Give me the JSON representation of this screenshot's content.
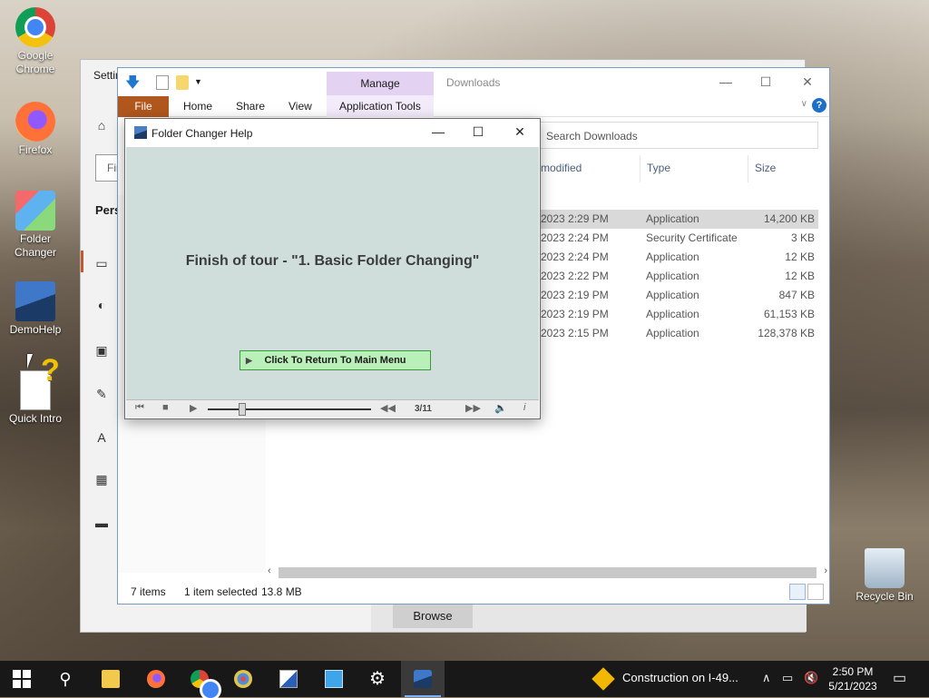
{
  "desktop": {
    "icons": [
      {
        "label": "Google\nChrome",
        "icon": "chrome-icon"
      },
      {
        "label": "Firefox",
        "icon": "firefox-icon"
      },
      {
        "label": "Folder\nChanger",
        "icon": "folder-changer-icon"
      },
      {
        "label": "DemoHelp",
        "icon": "demohelp-icon"
      },
      {
        "label": "Quick Intro",
        "icon": "quick-intro-icon"
      },
      {
        "label": "Recycle Bin",
        "icon": "recycle-bin-icon"
      }
    ]
  },
  "settings": {
    "title": "Settin",
    "find_placeholder": "Fin",
    "section": "Pers",
    "browse_label": "Browse"
  },
  "explorer": {
    "title": "Downloads",
    "manage_label": "Manage",
    "ribbon_tabs": [
      "File",
      "Home",
      "Share",
      "View",
      "Application Tools"
    ],
    "search_placeholder": "Search Downloads",
    "columns": {
      "modified": "modified",
      "type": "Type",
      "size": "Size"
    },
    "rows": [
      {
        "date": "2023 2:29 PM",
        "type": "Application",
        "size": "14,200 KB",
        "selected": true
      },
      {
        "date": "2023 2:24 PM",
        "type": "Security Certificate",
        "size": "3 KB"
      },
      {
        "date": "2023 2:24 PM",
        "type": "Application",
        "size": "12 KB"
      },
      {
        "date": "2023 2:22 PM",
        "type": "Application",
        "size": "12 KB"
      },
      {
        "date": "2023 2:19 PM",
        "type": "Application",
        "size": "847 KB"
      },
      {
        "date": "2023 2:19 PM",
        "type": "Application",
        "size": "61,153 KB"
      },
      {
        "date": "2023 2:15 PM",
        "type": "Application",
        "size": "128,378 KB"
      }
    ],
    "status": {
      "items": "7 items",
      "selected": "1 item selected",
      "size": "13.8 MB"
    }
  },
  "help_dialog": {
    "title": "Folder Changer Help",
    "message": "Finish of tour - \"1. Basic Folder Changing\"",
    "return_button": "Click To Return To Main Menu",
    "counter": "3/11",
    "progress": 0.2
  },
  "taskbar": {
    "news": "Construction on I-49...",
    "time": "2:50 PM",
    "date": "5/21/2023"
  },
  "colors": {
    "file_tab": "#b0571d",
    "manage_tab": "#e4d2f2",
    "dialog_body": "#cfdedb",
    "return_button": "#b9f0b9",
    "taskbar": "#181818"
  }
}
